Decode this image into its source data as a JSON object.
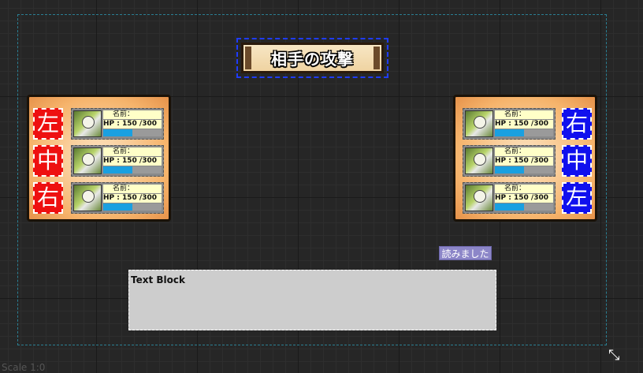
{
  "title": "相手の攻撃",
  "left_panel": {
    "color": "#ee1010",
    "positions": [
      "左",
      "中",
      "右"
    ],
    "units": [
      {
        "name_label": "名前：",
        "hp_text": "HP : 150 /300",
        "hp_current": 150,
        "hp_max": 300
      },
      {
        "name_label": "名前：",
        "hp_text": "HP : 150 /300",
        "hp_current": 150,
        "hp_max": 300
      },
      {
        "name_label": "名前：",
        "hp_text": "HP : 150 /300",
        "hp_current": 150,
        "hp_max": 300
      }
    ]
  },
  "right_panel": {
    "color": "#1010ee",
    "positions": [
      "右",
      "中",
      "左"
    ],
    "units": [
      {
        "name_label": "名前：",
        "hp_text": "HP : 150 /300",
        "hp_current": 150,
        "hp_max": 300
      },
      {
        "name_label": "名前：",
        "hp_text": "HP : 150 /300",
        "hp_current": 150,
        "hp_max": 300
      },
      {
        "name_label": "名前：",
        "hp_text": "HP : 150 /300",
        "hp_current": 150,
        "hp_max": 300
      }
    ]
  },
  "read_button_label": "読みました",
  "text_block_label": "Text Block",
  "zoom_label": "Scale 1:0",
  "colors": {
    "hp_fill": "#1aa0e0",
    "button_bg": "#8c86c8",
    "canvas_border": "#2a7f93"
  }
}
